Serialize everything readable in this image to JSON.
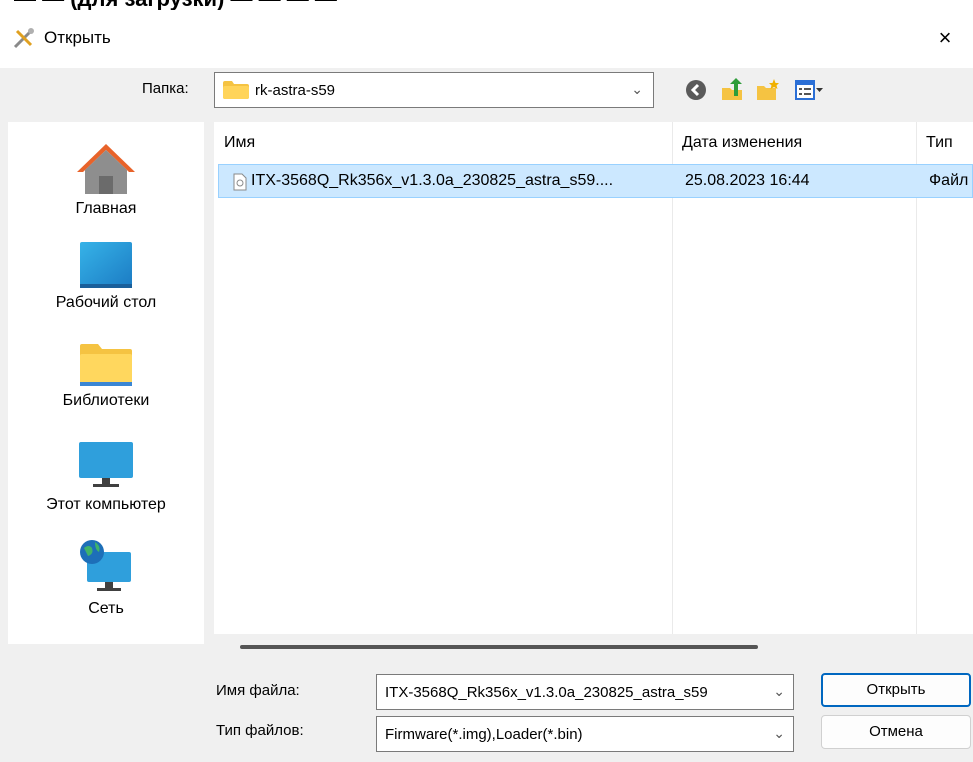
{
  "dialog": {
    "title": "Открыть",
    "close_glyph": "×"
  },
  "toolbar": {
    "folder_label": "Папка:",
    "folder_value": "rk-astra-s59",
    "icons": [
      "back-icon",
      "up-folder-icon",
      "new-folder-icon",
      "view-menu-icon"
    ]
  },
  "places": [
    {
      "label": "Главная",
      "icon": "home-icon"
    },
    {
      "label": "Рабочий стол",
      "icon": "desktop-icon"
    },
    {
      "label": "Библиотеки",
      "icon": "libraries-icon"
    },
    {
      "label": "Этот компьютер",
      "icon": "this-pc-icon"
    },
    {
      "label": "Сеть",
      "icon": "network-icon"
    }
  ],
  "file_list": {
    "columns": [
      "Имя",
      "Дата изменения",
      "Тип"
    ],
    "rows": [
      {
        "name": "ITX-3568Q_Rk356x_v1.3.0a_230825_astra_s59....",
        "date": "25.08.2023 16:44",
        "type": "Файл"
      }
    ]
  },
  "footer": {
    "filename_label": "Имя файла:",
    "filename_value": "ITX-3568Q_Rk356x_v1.3.0a_230825_astra_s59",
    "filetype_label": "Тип файлов:",
    "filetype_value": "Firmware(*.img),Loader(*.bin)",
    "open_button": "Открыть",
    "cancel_button": "Отмена"
  },
  "colors": {
    "selection": "#cce8ff",
    "accent": "#0067c0",
    "folder": "#f5c342"
  }
}
